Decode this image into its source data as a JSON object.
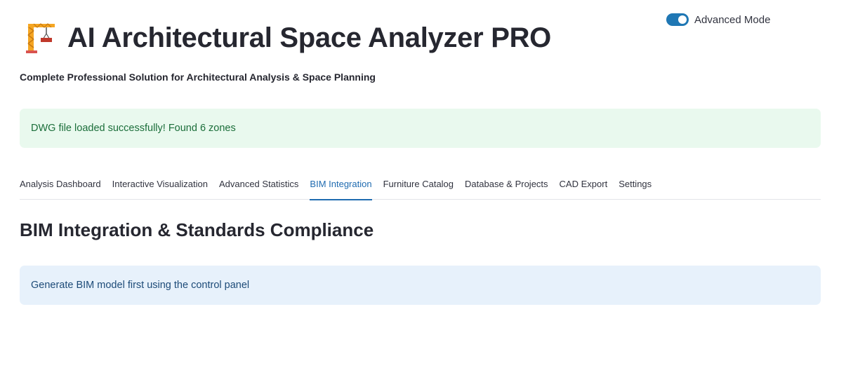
{
  "header": {
    "title": "AI Architectural Space Analyzer PRO",
    "subtitle": "Complete Professional Solution for Architectural Analysis & Space Planning",
    "icon": "construction-crane-icon"
  },
  "advanced_mode": {
    "label": "Advanced Mode",
    "enabled": true,
    "accent_color": "#1f77b4"
  },
  "alerts": {
    "success": "DWG file loaded successfully! Found 6 zones",
    "info": "Generate BIM model first using the control panel"
  },
  "tabs": [
    {
      "label": "Analysis Dashboard",
      "active": false
    },
    {
      "label": "Interactive Visualization",
      "active": false
    },
    {
      "label": "Advanced Statistics",
      "active": false
    },
    {
      "label": "BIM Integration",
      "active": true
    },
    {
      "label": "Furniture Catalog",
      "active": false
    },
    {
      "label": "Database & Projects",
      "active": false
    },
    {
      "label": "CAD Export",
      "active": false
    },
    {
      "label": "Settings",
      "active": false
    }
  ],
  "main": {
    "heading": "BIM Integration & Standards Compliance"
  }
}
